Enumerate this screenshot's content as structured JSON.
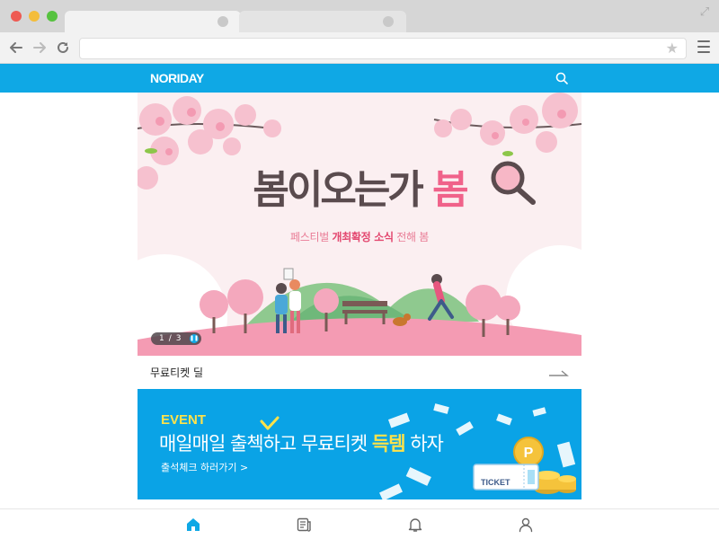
{
  "brand": {
    "logo_text": "NORIDAY",
    "accent": "#0fa8e5",
    "pink": "#f0628a",
    "yellow": "#ffe24a"
  },
  "hero": {
    "title_main": "봄이오는가",
    "title_accent": "봄",
    "subtitle_pre": "페스티벌 ",
    "subtitle_bold": "개최확정 소식",
    "subtitle_post": " 전해 봄",
    "pager": {
      "current": "1",
      "separator": "/",
      "total": "3"
    }
  },
  "deal": {
    "title": "무료티켓 딜"
  },
  "banner": {
    "event_label": "EVENT",
    "headline_pre": "매일매일 출첵하고 무료티켓 ",
    "headline_highlight": "득템",
    "headline_post": " 하자",
    "link_label": "출석체크 하러가기 >",
    "ticket_label": "TICKET"
  },
  "bottom_nav": {
    "items": [
      {
        "icon": "home-icon",
        "active": true
      },
      {
        "icon": "news-icon",
        "active": false
      },
      {
        "icon": "bell-icon",
        "active": false
      },
      {
        "icon": "user-icon",
        "active": false
      }
    ]
  }
}
